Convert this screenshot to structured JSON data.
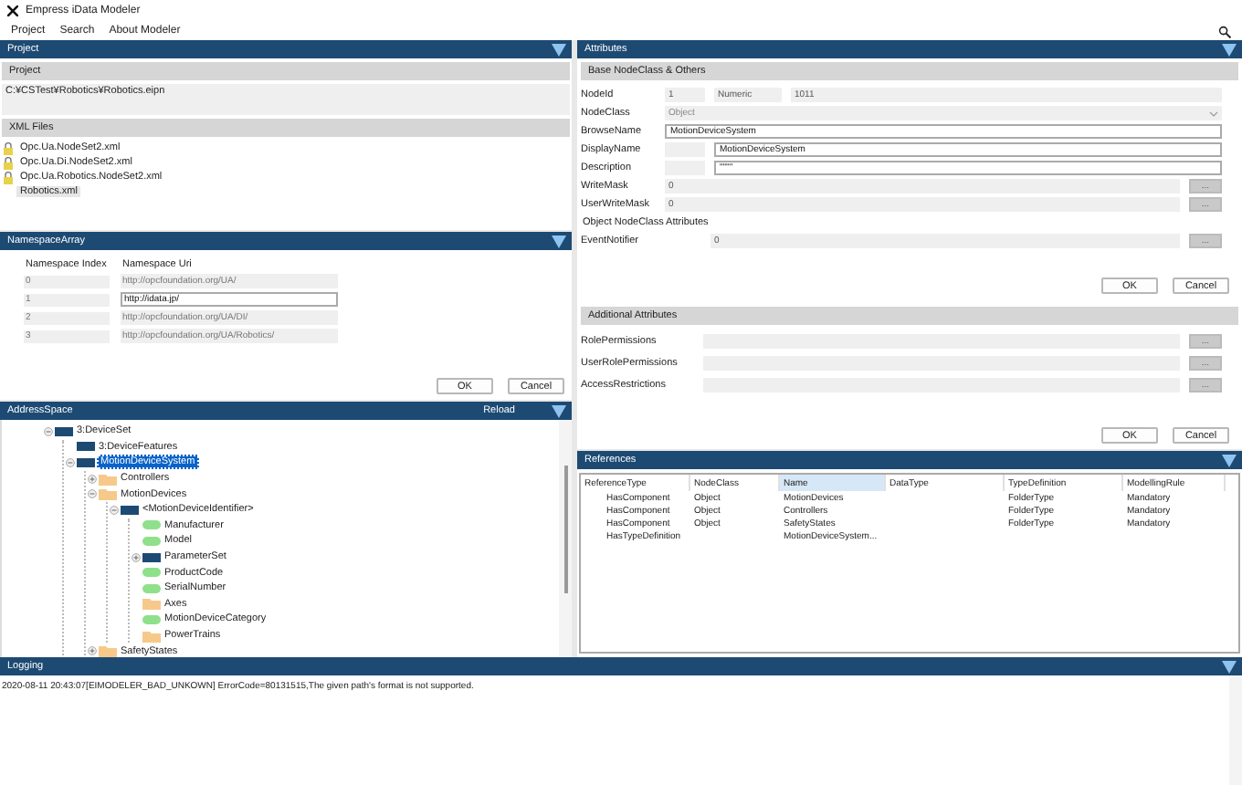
{
  "window": {
    "title": "Empress iData Modeler"
  },
  "menu": [
    "Project",
    "Search",
    "About Modeler"
  ],
  "project": {
    "title": "Project",
    "section": "Project",
    "path": "C:¥CSTest¥Robotics¥Robotics.eipn",
    "xml_section": "XML Files",
    "xml_files": [
      {
        "name": "Opc.Ua.NodeSet2.xml",
        "locked": true,
        "selected": false
      },
      {
        "name": "Opc.Ua.Di.NodeSet2.xml",
        "locked": true,
        "selected": false
      },
      {
        "name": "Opc.Ua.Robotics.NodeSet2.xml",
        "locked": true,
        "selected": false
      },
      {
        "name": "Robotics.xml",
        "locked": false,
        "selected": true
      }
    ]
  },
  "namespace_array": {
    "title": "NamespaceArray",
    "columns": [
      "Namespace Index",
      "Namespace Uri"
    ],
    "rows": [
      {
        "index": "0",
        "uri": "http://opcfoundation.org/UA/",
        "editable": false
      },
      {
        "index": "1",
        "uri": "http://idata.jp/",
        "editable": true
      },
      {
        "index": "2",
        "uri": "http://opcfoundation.org/UA/DI/",
        "editable": false
      },
      {
        "index": "3",
        "uri": "http://opcfoundation.org/UA/Robotics/",
        "editable": false
      }
    ],
    "buttons": [
      "OK",
      "Cancel"
    ]
  },
  "address_space": {
    "title": "AddressSpace",
    "reload": "Reload",
    "tree": [
      {
        "label": "3:DeviceSet",
        "kind": "object",
        "expanded": true,
        "selected": false,
        "children": [
          {
            "label": "3:DeviceFeatures",
            "kind": "object",
            "selected": false
          },
          {
            "label": "MotionDeviceSystem",
            "kind": "object",
            "expanded": true,
            "selected": true,
            "children": [
              {
                "label": "Controllers",
                "kind": "folder",
                "expanded": false,
                "selected": false
              },
              {
                "label": "MotionDevices",
                "kind": "folder",
                "expanded": true,
                "selected": false,
                "children": [
                  {
                    "label": "<MotionDeviceIdentifier>",
                    "kind": "object",
                    "expanded": true,
                    "selected": false,
                    "children": [
                      {
                        "label": "Manufacturer",
                        "kind": "variable",
                        "selected": false
                      },
                      {
                        "label": "Model",
                        "kind": "variable",
                        "selected": false
                      },
                      {
                        "label": "ParameterSet",
                        "kind": "object",
                        "expanded": false,
                        "selected": false
                      },
                      {
                        "label": "ProductCode",
                        "kind": "variable",
                        "selected": false
                      },
                      {
                        "label": "SerialNumber",
                        "kind": "variable",
                        "selected": false
                      },
                      {
                        "label": "Axes",
                        "kind": "folder",
                        "selected": false
                      },
                      {
                        "label": "MotionDeviceCategory",
                        "kind": "variable",
                        "selected": false
                      },
                      {
                        "label": "PowerTrains",
                        "kind": "folder",
                        "selected": false
                      }
                    ]
                  }
                ]
              },
              {
                "label": "SafetyStates",
                "kind": "folder",
                "expanded": false,
                "selected": false
              }
            ]
          }
        ]
      }
    ]
  },
  "attributes": {
    "title": "Attributes",
    "base_section": "Base NodeClass & Others",
    "base_fields": [
      {
        "kind": "ids",
        "label": "NodeId",
        "values": [
          "1",
          "Numeric",
          "1011"
        ]
      },
      {
        "kind": "select",
        "label": "NodeClass",
        "value": "Object"
      },
      {
        "kind": "text",
        "label": "BrowseName",
        "value": "MotionDeviceSystem"
      },
      {
        "kind": "localized",
        "label": "DisplayName",
        "value": "MotionDeviceSystem"
      },
      {
        "kind": "localized",
        "label": "Description",
        "value": "\"\"\"\""
      },
      {
        "kind": "mask",
        "label": "WriteMask",
        "value": "0",
        "button": "..."
      },
      {
        "kind": "mask",
        "label": "UserWriteMask",
        "value": "0",
        "button": "..."
      },
      {
        "kind": "section",
        "label": "Object NodeClass Attributes"
      },
      {
        "kind": "notifier",
        "label": "EventNotifier",
        "value": "0",
        "button": "..."
      }
    ],
    "base_buttons": [
      "OK",
      "Cancel"
    ],
    "additional_section": "Additional Attributes",
    "additional_fields": [
      {
        "label": "RolePermissions",
        "button": "..."
      },
      {
        "label": "UserRolePermissions",
        "button": "..."
      },
      {
        "label": "AccessRestrictions",
        "button": "..."
      }
    ],
    "additional_buttons": [
      "OK",
      "Cancel"
    ]
  },
  "references": {
    "title": "References",
    "columns": [
      {
        "label": "ReferenceType",
        "selected": false
      },
      {
        "label": "NodeClass",
        "selected": false
      },
      {
        "label": "Name",
        "selected": true
      },
      {
        "label": "DataType",
        "selected": false
      },
      {
        "label": "TypeDefinition",
        "selected": false
      },
      {
        "label": "ModellingRule",
        "selected": false
      }
    ],
    "rows": [
      [
        "HasComponent",
        "Object",
        "MotionDevices",
        "",
        "FolderType",
        "Mandatory"
      ],
      [
        "HasComponent",
        "Object",
        "Controllers",
        "",
        "FolderType",
        "Mandatory"
      ],
      [
        "HasComponent",
        "Object",
        "SafetyStates",
        "",
        "FolderType",
        "Mandatory"
      ],
      [
        "HasTypeDefinition",
        "",
        "MotionDeviceSystem...",
        "",
        "",
        ""
      ]
    ]
  },
  "logging": {
    "title": "Logging",
    "lines": [
      "2020-08-11 20:43:07[EIMODELER_BAD_UNKOWN] ErrorCode=80131515,The given path's format is not supported."
    ]
  }
}
